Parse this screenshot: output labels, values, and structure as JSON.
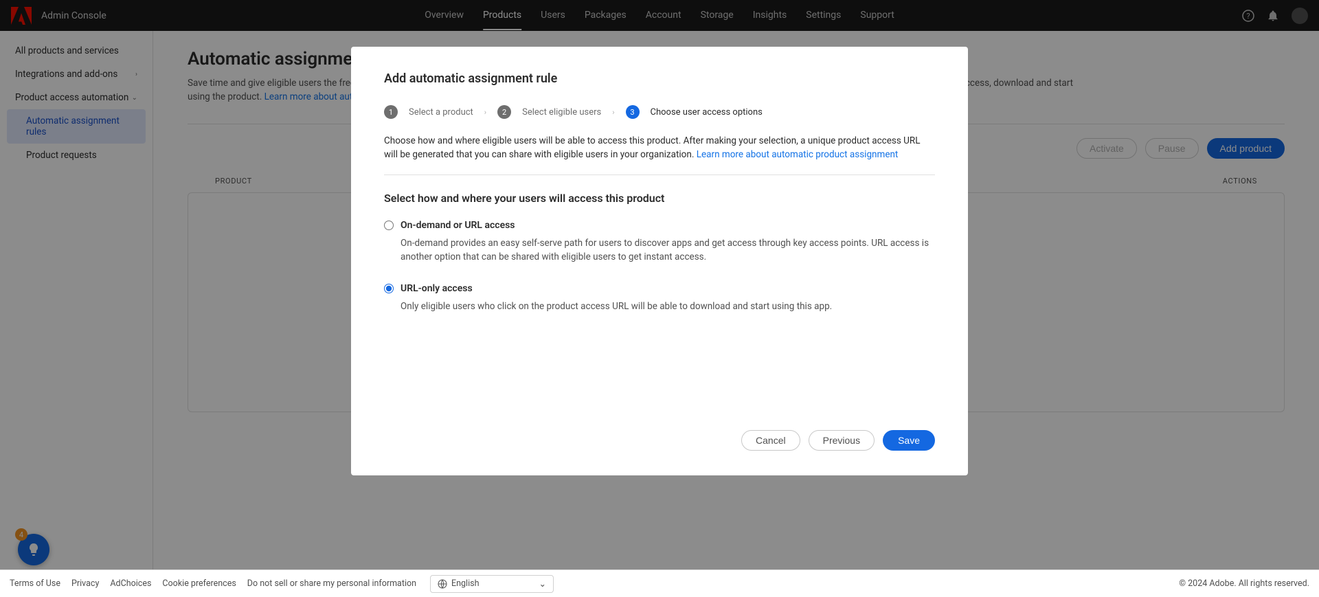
{
  "header": {
    "app_name": "Admin Console",
    "nav": [
      "Overview",
      "Products",
      "Users",
      "Packages",
      "Account",
      "Storage",
      "Insights",
      "Settings",
      "Support"
    ],
    "active_nav": "Products"
  },
  "sidebar": {
    "items": [
      {
        "label": "All products and services"
      },
      {
        "label": "Integrations and add-ons",
        "chevron": true
      },
      {
        "label": "Product access automation",
        "chevron": true,
        "expanded": true
      },
      {
        "label": "Automatic assignment rules",
        "sub": true,
        "active": true
      },
      {
        "label": "Product requests",
        "sub": true
      }
    ]
  },
  "page": {
    "title": "Automatic assignment rules",
    "desc_prefix": "Save time and give eligible users the freedom to access products instantly. Add automatic assignment rules, so that users don't need to get access to a specific product profile to be able to access, download and start using the product. ",
    "learn_more": "Learn more about automatic product assignment"
  },
  "toolbar": {
    "activate": "Activate",
    "pause": "Pause",
    "add_product": "Add product"
  },
  "table": {
    "col_product": "PRODUCT",
    "col_actions": "ACTIONS"
  },
  "modal": {
    "title": "Add automatic assignment rule",
    "steps": [
      {
        "num": "1",
        "label": "Select a product"
      },
      {
        "num": "2",
        "label": "Select eligible users"
      },
      {
        "num": "3",
        "label": "Choose user access options"
      }
    ],
    "active_step": 3,
    "desc": "Choose how and where eligible users will be able to access this product. After making your selection, a unique product access URL will be generated that you can share with eligible users in your organization.  ",
    "learn_more": "Learn more about automatic product assignment",
    "section_heading": "Select how and where your users will access this product",
    "options": [
      {
        "key": "ondemand",
        "title": "On-demand or URL access",
        "body": "On-demand provides an easy self-serve path for users to discover apps and get access through key access points. URL access is another option that can be shared with eligible users to get instant access."
      },
      {
        "key": "urlonly",
        "title": "URL-only access",
        "body": "Only eligible users who click on the product access URL will be able to download and start using this app."
      }
    ],
    "selected_option": "urlonly",
    "cancel": "Cancel",
    "previous": "Previous",
    "save": "Save"
  },
  "footer": {
    "links": [
      "Terms of Use",
      "Privacy",
      "AdChoices",
      "Cookie preferences",
      "Do not sell or share my personal information"
    ],
    "language": "English",
    "copyright": "© 2024 Adobe. All rights reserved."
  },
  "fab": {
    "badge": "4"
  }
}
